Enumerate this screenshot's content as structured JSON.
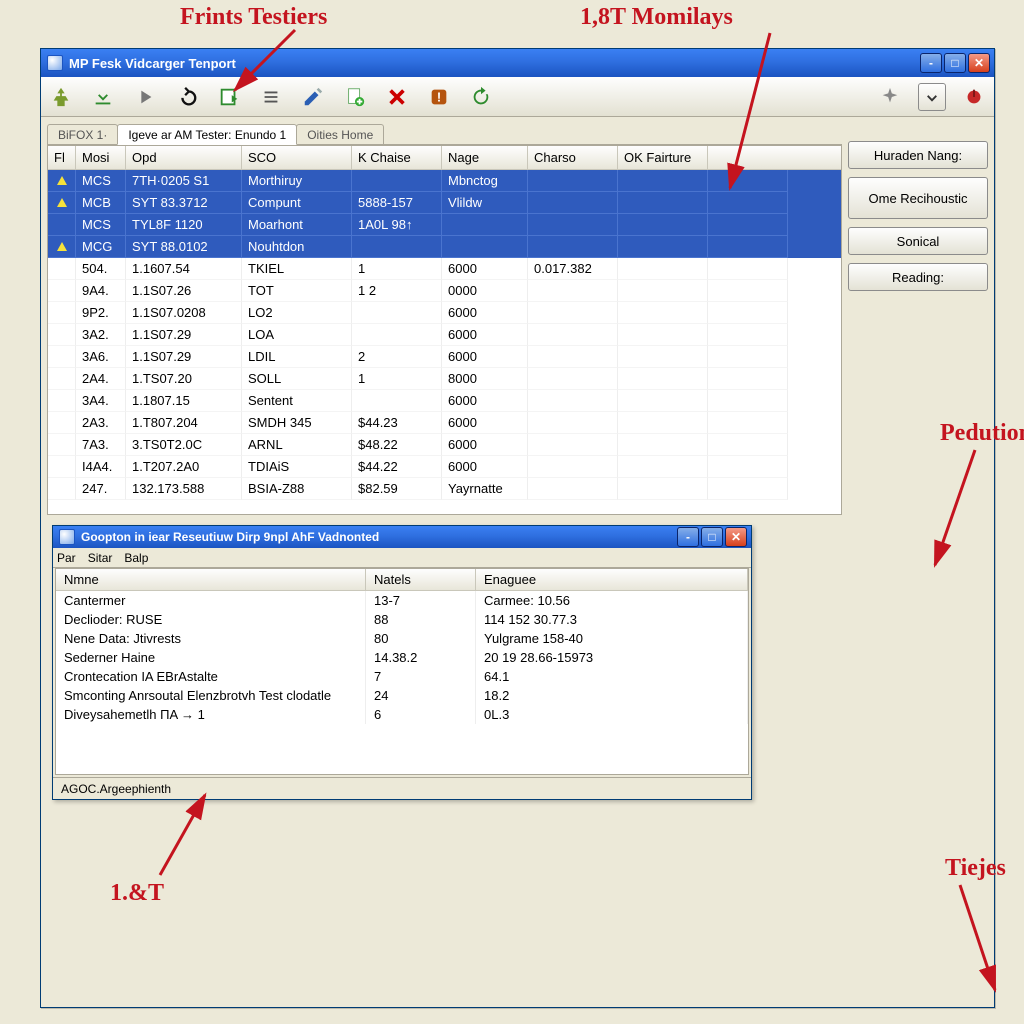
{
  "annotations": {
    "top_left": "Frints Testiers",
    "top_right": "1,8T Momilays",
    "right_1": "Pedution",
    "right_2": "Tiejes",
    "bottom_left": "1.&T"
  },
  "main_window": {
    "title": "MP Fesk Vidcarger Tenport",
    "toolbar_icons": [
      "tree-icon",
      "download-icon",
      "play-icon",
      "undo-icon",
      "export-icon",
      "list-icon",
      "edit-icon",
      "add-page-icon",
      "delete-icon",
      "warning-icon",
      "refresh-icon"
    ],
    "toolbar_icons_right": [
      "spark-icon",
      "download-arrow-icon",
      "flag-icon"
    ],
    "tabs": [
      {
        "label": "BiFOX 1·"
      },
      {
        "label": "Igeve ar AM Tester: Enundo 1"
      },
      {
        "label": "Oities Home"
      }
    ],
    "active_tab": 1,
    "grid": {
      "columns": [
        "Fl",
        "Mosi",
        "Opd",
        "SCO",
        "K Chaise",
        "Nage",
        "Charso",
        "OK Fairture"
      ],
      "rows": [
        {
          "sel": true,
          "ico": true,
          "c": [
            "MCS",
            "7TH·0205 S1",
            "Morthiruy",
            "",
            "Mbnctog",
            "",
            "",
            ""
          ]
        },
        {
          "sel": true,
          "ico": true,
          "c": [
            "MCB",
            "SYT  83.3712",
            "Compunt",
            "5888-157",
            "Vlildw",
            "",
            "",
            ""
          ]
        },
        {
          "sel": true,
          "ico": false,
          "c": [
            "MCS",
            "TYL8F 1120",
            "Moarhont",
            "1A0L  98↑",
            "",
            "",
            "",
            ""
          ]
        },
        {
          "sel": true,
          "ico": true,
          "c": [
            "MCG",
            "SYT  88.0102",
            "Nouhtdon",
            "",
            "",
            "",
            "",
            ""
          ]
        },
        {
          "sel": false,
          "ico": false,
          "c": [
            "504.",
            "1.1607.54",
            "TKIEL",
            "1",
            "6000",
            "0.017.382",
            "",
            ""
          ]
        },
        {
          "sel": false,
          "ico": false,
          "c": [
            "9A4.",
            "1.1S07.26",
            "TOT",
            "1   2",
            "0000",
            "",
            "",
            ""
          ]
        },
        {
          "sel": false,
          "ico": false,
          "c": [
            "9P2.",
            "1.1S07.0208",
            "LO2",
            "",
            "6000",
            "",
            "",
            ""
          ]
        },
        {
          "sel": false,
          "ico": false,
          "c": [
            "3A2.",
            "1.1S07.29",
            "LOA",
            "",
            "6000",
            "",
            "",
            ""
          ]
        },
        {
          "sel": false,
          "ico": false,
          "c": [
            "3A6.",
            "1.1S07.29",
            "LDIL",
            "2",
            "6000",
            "",
            "",
            ""
          ]
        },
        {
          "sel": false,
          "ico": false,
          "c": [
            "2A4.",
            "1.TS07.20",
            "SOLL",
            "1",
            "8000",
            "",
            "",
            ""
          ]
        },
        {
          "sel": false,
          "ico": false,
          "c": [
            "3A4.",
            "1.1807.15",
            "Sentent",
            "",
            "6000",
            "",
            "",
            ""
          ]
        },
        {
          "sel": false,
          "ico": false,
          "c": [
            "2A3.",
            "1.T807.204",
            "SMDH 345",
            "$44.23",
            "6000",
            "",
            "",
            ""
          ]
        },
        {
          "sel": false,
          "ico": false,
          "c": [
            "7A3.",
            "3.TS0T2.0C",
            "ARNL",
            "$48.22",
            "6000",
            "",
            "",
            ""
          ]
        },
        {
          "sel": false,
          "ico": false,
          "c": [
            "I4A4.",
            "1.T207.2A0",
            "TDIAiS",
            "$44.22",
            "6000",
            "",
            "",
            ""
          ]
        },
        {
          "sel": false,
          "ico": false,
          "c": [
            "247.",
            "132.173.588",
            "BSIA-Z88",
            "$82.59",
            "Yayrnatte",
            "",
            "",
            ""
          ]
        }
      ]
    },
    "side_buttons": [
      "Huraden Nang:",
      "Ome Recihoustic",
      "Sonical",
      "Reading:"
    ]
  },
  "sub_window": {
    "title": "Goopton in iear Reseutiuw Dirp 9npl AhF Vadnonted",
    "menus": [
      "Par",
      "Sitar",
      "Balp"
    ],
    "columns": [
      "Nmne",
      "Natels",
      "Enaguee"
    ],
    "rows": [
      [
        "Cantermer",
        "13-7",
        "Carmee: 10.56"
      ],
      [
        "Declioder: RUSE",
        "88",
        "114 152 30.77.3"
      ],
      [
        "Nene Data: Jtivrests",
        "80",
        "Yulgrame 158-40"
      ],
      [
        "Sederner  Haine",
        "14.38.2",
        "20 19  28.66-15973"
      ],
      [
        "Crontecation IA EBrAstalte",
        "7",
        "64.1"
      ],
      [
        "Smconting Anrsoutal Elenzbrotvh Test clodatle",
        "24",
        "18.2"
      ],
      [
        "Diveysahemetlh ПA  → 1",
        "6",
        "0L.3"
      ]
    ],
    "status": "AGOC.Argeephienth"
  }
}
